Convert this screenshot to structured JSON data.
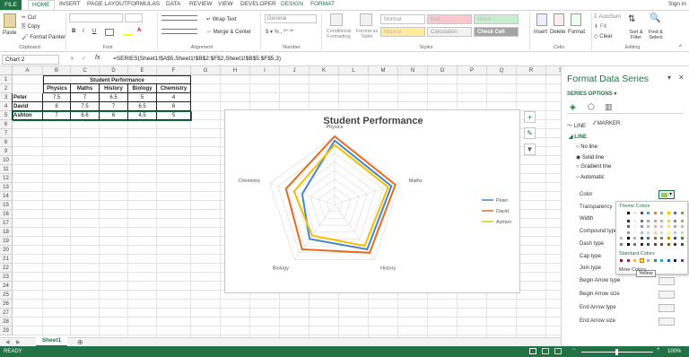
{
  "tabs": [
    "FILE",
    "HOME",
    "INSERT",
    "PAGE LAYOUT",
    "FORMULAS",
    "DATA",
    "REVIEW",
    "VIEW",
    "DEVELOPER",
    "DESIGN",
    "FORMAT"
  ],
  "signin": "Sign in",
  "ribbon": {
    "paste": "Paste",
    "cut": "Cut",
    "copy": "Copy",
    "format_painter": "Format Painter",
    "clipboard": "Clipboard",
    "font": "Font",
    "alignment": "Alignment",
    "wrap_text": "Wrap Text",
    "merge_center": "Merge & Center",
    "number_format": "General",
    "number": "Number",
    "conditional_formatting": "Conditional Formatting",
    "format_as_table": "Format as Table",
    "styles": "Styles",
    "style_cells": [
      "Normal",
      "Bad",
      "Good",
      "Neutral",
      "Calculation",
      "Check Cell"
    ],
    "insert": "Insert",
    "delete": "Delete",
    "format": "Format",
    "cells": "Cells",
    "autosum": "AutoSum",
    "fill": "Fill",
    "clear": "Clear",
    "sort_filter": "Sort & Filter",
    "find_select": "Find & Select",
    "editing": "Editing"
  },
  "formula_bar": {
    "name_box": "Chart 2",
    "fx": "fx",
    "formula": "=SERIES(Sheet1!$A$5,Sheet1!$B$2:$F$2,Sheet1!$B$5:$F$5,3)"
  },
  "columns": [
    "A",
    "B",
    "C",
    "D",
    "E",
    "F",
    "G",
    "H",
    "I",
    "J",
    "K",
    "L",
    "M",
    "N",
    "O",
    "P",
    "Q",
    "R",
    "S"
  ],
  "rows": [
    "1",
    "2",
    "3",
    "4",
    "5",
    "6",
    "7",
    "8",
    "9",
    "10",
    "11",
    "12",
    "13",
    "14",
    "15",
    "16",
    "17",
    "18",
    "19",
    "20",
    "21",
    "22",
    "23",
    "24",
    "25",
    "26",
    "27",
    "28",
    "29"
  ],
  "table": {
    "title": "Student Performance",
    "headers": [
      "Physics",
      "Maths",
      "History",
      "Biology",
      "Chemistry"
    ],
    "rows": [
      {
        "name": "Peter",
        "values": [
          "7.5",
          "7",
          "6.5",
          "5",
          "4"
        ]
      },
      {
        "name": "David",
        "values": [
          "8",
          "7.5",
          "7",
          "6.5",
          "6"
        ]
      },
      {
        "name": "Ashton",
        "values": [
          "7",
          "6.6",
          "6",
          "4.5",
          "5"
        ]
      }
    ]
  },
  "chart_data": {
    "type": "radar",
    "title": "Student Performance",
    "categories": [
      "Physics",
      "Maths",
      "History",
      "Biology",
      "Chemistry"
    ],
    "series": [
      {
        "name": "Peter",
        "values": [
          7.5,
          7,
          6.5,
          5,
          4
        ],
        "color": "#4a86c6"
      },
      {
        "name": "David",
        "values": [
          8,
          7.5,
          7,
          6.5,
          6
        ],
        "color": "#e46c1f"
      },
      {
        "name": "Ashton",
        "values": [
          7,
          6.6,
          6,
          4.5,
          5
        ],
        "color": "#f2c000"
      }
    ],
    "rmax": 8,
    "legend": "right"
  },
  "panel": {
    "title": "Format Data Series",
    "series_options": "SERIES OPTIONS",
    "tab_line": "LINE",
    "tab_marker": "MARKER",
    "section_line": "LINE",
    "options": [
      "No line",
      "Solid line",
      "Gradient line",
      "Automatic"
    ],
    "props": [
      "Color",
      "Transparency",
      "Width",
      "Compound type",
      "Dash type",
      "Cap type",
      "Join type",
      "Begin Arrow type",
      "Begin Arrow size",
      "End Arrow type",
      "End Arrow size"
    ],
    "theme_colors": "Theme Colors",
    "standard_colors": "Standard Colors",
    "more_colors": "More Colors...",
    "tooltip": "Yellow"
  },
  "sheet": "Sheet1",
  "status": {
    "ready": "READY",
    "zoom": "100%"
  }
}
